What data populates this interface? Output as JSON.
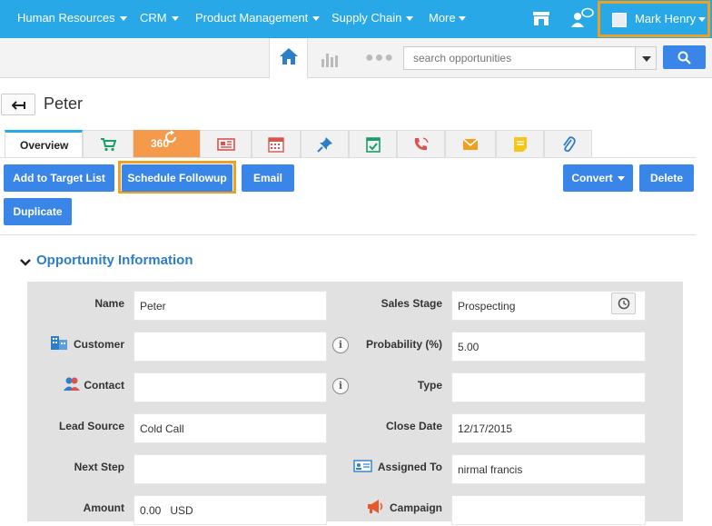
{
  "nav": {
    "items": [
      "Human Resources",
      "CRM",
      "Product Management",
      "Supply Chain",
      "More"
    ],
    "user_name": "Mark Henry"
  },
  "search": {
    "placeholder": "search opportunities"
  },
  "page": {
    "title": "Peter"
  },
  "tabs": {
    "overview": "Overview",
    "icons": [
      "cart-icon",
      "360-icon",
      "newspaper-icon",
      "calendar-icon",
      "pin-icon",
      "checklist-icon",
      "phone-icon",
      "email-icon",
      "notes-icon",
      "paperclip-icon"
    ],
    "badge_360": "360"
  },
  "actions": {
    "add_target": "Add to Target List",
    "schedule_followup": "Schedule Followup",
    "email": "Email",
    "convert": "Convert",
    "delete": "Delete",
    "duplicate": "Duplicate"
  },
  "section": {
    "title": "Opportunity Information"
  },
  "fields": {
    "name": {
      "label": "Name",
      "value": "Peter"
    },
    "customer": {
      "label": "Customer",
      "value": ""
    },
    "contact": {
      "label": "Contact",
      "value": ""
    },
    "lead_source": {
      "label": "Lead Source",
      "value": "Cold Call"
    },
    "next_step": {
      "label": "Next Step",
      "value": ""
    },
    "amount": {
      "label": "Amount",
      "value": "0.00",
      "currency": "USD"
    },
    "sales_stage": {
      "label": "Sales Stage",
      "value": "Prospecting"
    },
    "probability": {
      "label": "Probability (%)",
      "value": "5.00"
    },
    "type": {
      "label": "Type",
      "value": ""
    },
    "close_date": {
      "label": "Close Date",
      "value": "12/17/2015"
    },
    "assigned_to": {
      "label": "Assigned To",
      "value": "nirmal francis"
    },
    "campaign": {
      "label": "Campaign",
      "value": ""
    }
  },
  "colors": {
    "brand": "#29a8e8",
    "button": "#3a86e8",
    "highlight": "#f0a020",
    "tab_360": "#f59a4a"
  }
}
